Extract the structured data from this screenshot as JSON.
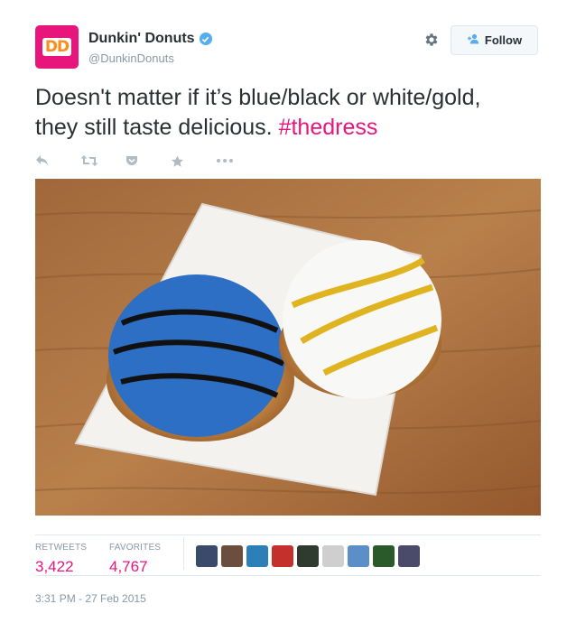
{
  "header": {
    "avatar_text": "DD",
    "display_name": "Dunkin' Donuts",
    "handle": "@DunkinDonuts",
    "follow_label": "Follow"
  },
  "tweet": {
    "text_line1": "Doesn't matter if it’s blue/black or white/gold,",
    "text_line2": "they still taste delicious.",
    "hashtag": "#thedress"
  },
  "actions": [
    {
      "name": "reply-icon"
    },
    {
      "name": "retweet-icon"
    },
    {
      "name": "pocket-icon"
    },
    {
      "name": "favorite-star-icon"
    },
    {
      "name": "more-icon"
    }
  ],
  "stats": {
    "retweets_label": "RETWEETS",
    "retweets_count": "3,422",
    "favorites_label": "FAVORITES",
    "favorites_count": "4,767"
  },
  "favoriters": [
    {
      "color": "#3a4a6a"
    },
    {
      "color": "#6b4e3d"
    },
    {
      "color": "#2d7fb8"
    },
    {
      "color": "#c4302b"
    },
    {
      "color": "#2f3b2f"
    },
    {
      "color": "#cfcfcf"
    },
    {
      "color": "#5a8fc7"
    },
    {
      "color": "#2a5a2a"
    },
    {
      "color": "#4a4a6a"
    }
  ],
  "timestamp": "3:31 PM - 27 Feb 2015",
  "colors": {
    "brand_pink": "#e8157d",
    "brand_orange": "#ff8c1a",
    "verified_blue": "#55acee",
    "muted_gray": "#8899a6",
    "text_dark": "#292f33"
  }
}
